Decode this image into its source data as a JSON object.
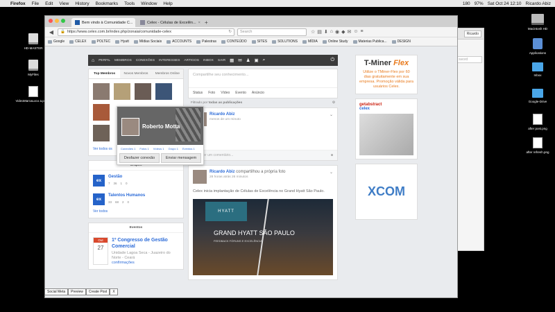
{
  "menubar": {
    "apple": "",
    "app": "Firefox",
    "items": [
      "File",
      "Edit",
      "View",
      "History",
      "Bookmarks",
      "Tools",
      "Window",
      "Help"
    ],
    "status": [
      "180",
      "97%",
      "Sat Oct 24  12:10",
      "Ricardo Abiz"
    ]
  },
  "desktop": {
    "icons": [
      {
        "label": "HD-MASTER",
        "type": "drive"
      },
      {
        "label": "MyFiles",
        "type": "drive"
      },
      {
        "label": "VideoMarcaLoco a.pages",
        "type": "doc"
      },
      {
        "label": "Macintosh HD",
        "type": "mac"
      },
      {
        "label": "Applications",
        "type": "app"
      },
      {
        "label": "Inbox",
        "type": "folder"
      },
      {
        "label": "Google-Drive",
        "type": "folder"
      },
      {
        "label": "after post.png",
        "type": "png"
      },
      {
        "label": "after refresh.png",
        "type": "png"
      }
    ]
  },
  "bgwindow": {
    "field": "Ricardo",
    "input": "sword"
  },
  "browser": {
    "tabs": [
      {
        "label": "Bem vindo à Comunidade C..."
      },
      {
        "label": "Celex - Células de Excelên..."
      }
    ],
    "url": "https://www.celex.com.br/index.php/zonaia/comunidade-celex",
    "search_placeholder": "Search",
    "bookmarks": [
      "Google",
      "CELEX",
      "POLTEC",
      "Hyatt",
      "Mídias Sociais",
      "ACCOUNTS",
      "Palestras",
      "CONTEÚDO",
      "SITES",
      "SOLUTIONS",
      "MÍDIA",
      "Online Study",
      "Materias Publica...",
      "DESIGN"
    ]
  },
  "nav": {
    "items": [
      "PERFIL",
      "MEMBROS",
      "CONEXÕES",
      "INTERESSES",
      "ARTIGOS",
      "INBOX",
      "SAIR"
    ]
  },
  "members": {
    "tabs": [
      "Top Membros",
      "Novos Membros",
      "Membros Online"
    ],
    "see_all": "Ver todos os"
  },
  "popup": {
    "name": "Roberto Motta",
    "stats": [
      "Conexões 1",
      "Fotos 1",
      "Vídeos 1",
      "Grupo 1",
      "Eventos 1"
    ],
    "disconnect": "Desfazer conexão",
    "message": "Enviar mensagem"
  },
  "groups": {
    "title": "Grupos",
    "items": [
      {
        "name": "Gestão",
        "stats": [
          "7",
          "36",
          "1",
          "0"
        ]
      },
      {
        "name": "Talentos Humanos",
        "stats": [
          "33",
          "68",
          "2",
          "0"
        ]
      }
    ],
    "see_all": "Ver todos"
  },
  "events": {
    "title": "Eventos",
    "item": {
      "month": "Out",
      "day": "27",
      "title": "1º Congresso de Gestão Comercial",
      "location": "Unidade Lagoa Seca - Juazeiro do Norte - Ceará",
      "link": "confirmações"
    }
  },
  "composer": {
    "placeholder": "Compartilhe seu conhecimento...",
    "tabs": [
      "Status",
      "Foto",
      "Vídeo",
      "Evento",
      "Anúncio"
    ]
  },
  "filter": {
    "prefix": "Filtrado por",
    "value": "todas as publicações"
  },
  "posts": [
    {
      "author": "Ricardo Abiz",
      "action": "",
      "time": "menos de um minuto",
      "body": "",
      "comment": "Escrever um comentário..."
    },
    {
      "author": "Ricardo Abiz",
      "action": "compartilhou a própria foto",
      "time": "28 horas atrás 26 minutos",
      "body": "Celex inicia implantação de Células de Excelência no Grand Hyatt São Paulo.",
      "image_title": "GRAND HYATT SÃO PAULO",
      "image_logo": "HYATT",
      "image_sub": "FEEDBACK FÓRUNS E EXCELÊNCIA"
    }
  ],
  "ads": {
    "tminer": {
      "brand": "T-Miner",
      "brand_accent": "Flex",
      "text": "Utilize o TMiner-Flex por 60 dias gratuitamente em sua empresa. Promoção válida para usuários Celex."
    },
    "getabstract": {
      "brand": "getabstract",
      "sub": "celex"
    },
    "xcom": {
      "brand": "XCOM",
      "accent": "O"
    }
  },
  "dock": [
    "Social Meta",
    "Preview",
    "Create Post",
    "X"
  ]
}
